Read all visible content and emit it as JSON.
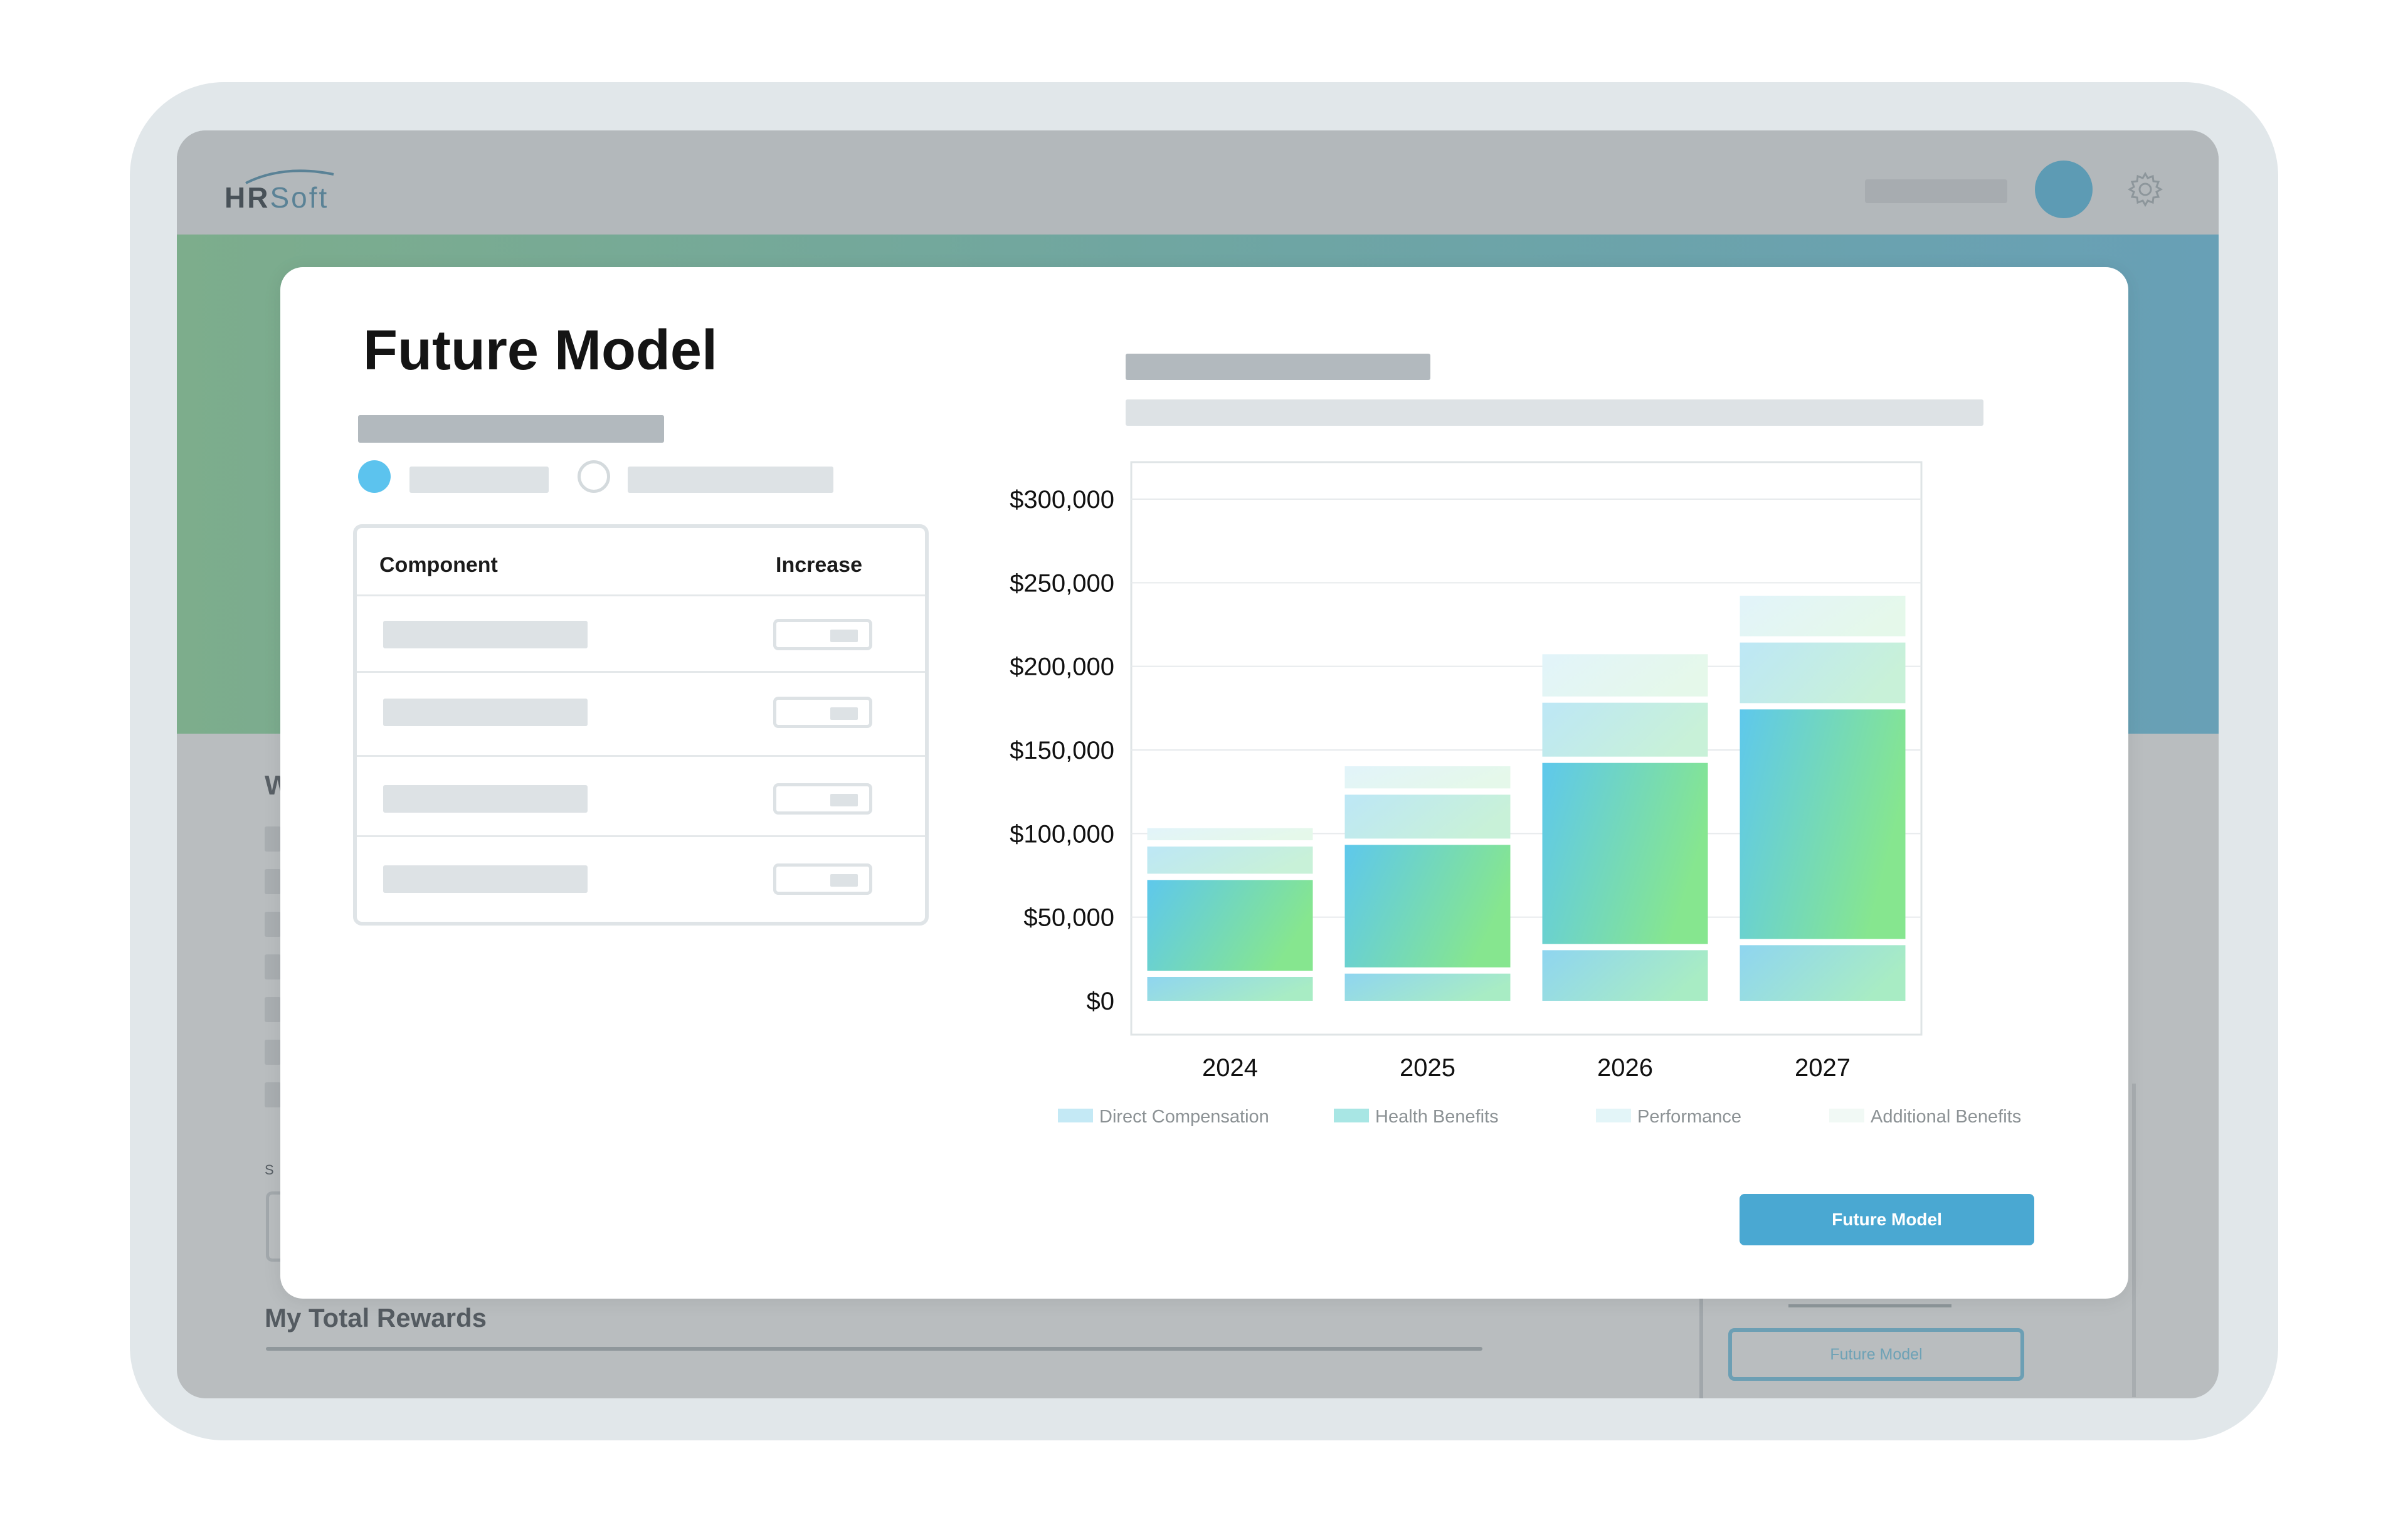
{
  "app": {
    "logo_text_a": "HR",
    "logo_text_b": "Soft",
    "icons": {
      "settings": "gear-icon",
      "avatar": "user-avatar"
    },
    "colors": {
      "hero_start": "#7dad8c",
      "hero_end": "#68a0b6",
      "accent": "#4aa8d2",
      "avatar": "#5d9bb4"
    }
  },
  "background_page": {
    "section_initial": "W",
    "select_label_initial": "S",
    "total_rewards_title": "My Total Rewards",
    "future_model_button": "Future Model"
  },
  "modal": {
    "title": "Future Model",
    "radio_options": [
      {
        "selected": true
      },
      {
        "selected": false
      }
    ],
    "table": {
      "col_component": "Component",
      "col_increase": "Increase",
      "rows": 4
    },
    "action_button": "Future Model"
  },
  "chart_data": {
    "type": "bar",
    "stacked": true,
    "title": "",
    "xlabel": "",
    "ylabel": "",
    "categories": [
      "2024",
      "2025",
      "2026",
      "2027"
    ],
    "y_tick_labels": [
      "$300,000",
      "$250,000",
      "$200,000",
      "$150,000",
      "$100,000",
      "$50,000",
      "$0"
    ],
    "ylim": [
      0,
      300000
    ],
    "y_ticks": [
      300000,
      250000,
      200000,
      150000,
      100000,
      50000,
      0
    ],
    "grid": true,
    "legend_position": "bottom",
    "series": [
      {
        "name": "Direct Compensation",
        "values": [
          18000,
          20000,
          34000,
          37000
        ],
        "color_from": "#8fd5f0",
        "color_to": "#a8ecc4"
      },
      {
        "name": "Health Benefits",
        "values": [
          58000,
          77000,
          112000,
          141000
        ],
        "color_from": "#5ec8ec",
        "color_to": "#86e68f"
      },
      {
        "name": "Performance",
        "values": [
          20000,
          30000,
          36000,
          40000
        ],
        "color_from": "#bde7f6",
        "color_to": "#c8f1d8"
      },
      {
        "name": "Additional Benefits",
        "values": [
          11000,
          17000,
          29000,
          28000
        ],
        "color_from": "#e2f4fa",
        "color_to": "#e5f8ea"
      }
    ],
    "legend_swatches": [
      "#c4e9f5",
      "#a8e6e4",
      "#e3f5f8",
      "#f1f9f5"
    ]
  }
}
